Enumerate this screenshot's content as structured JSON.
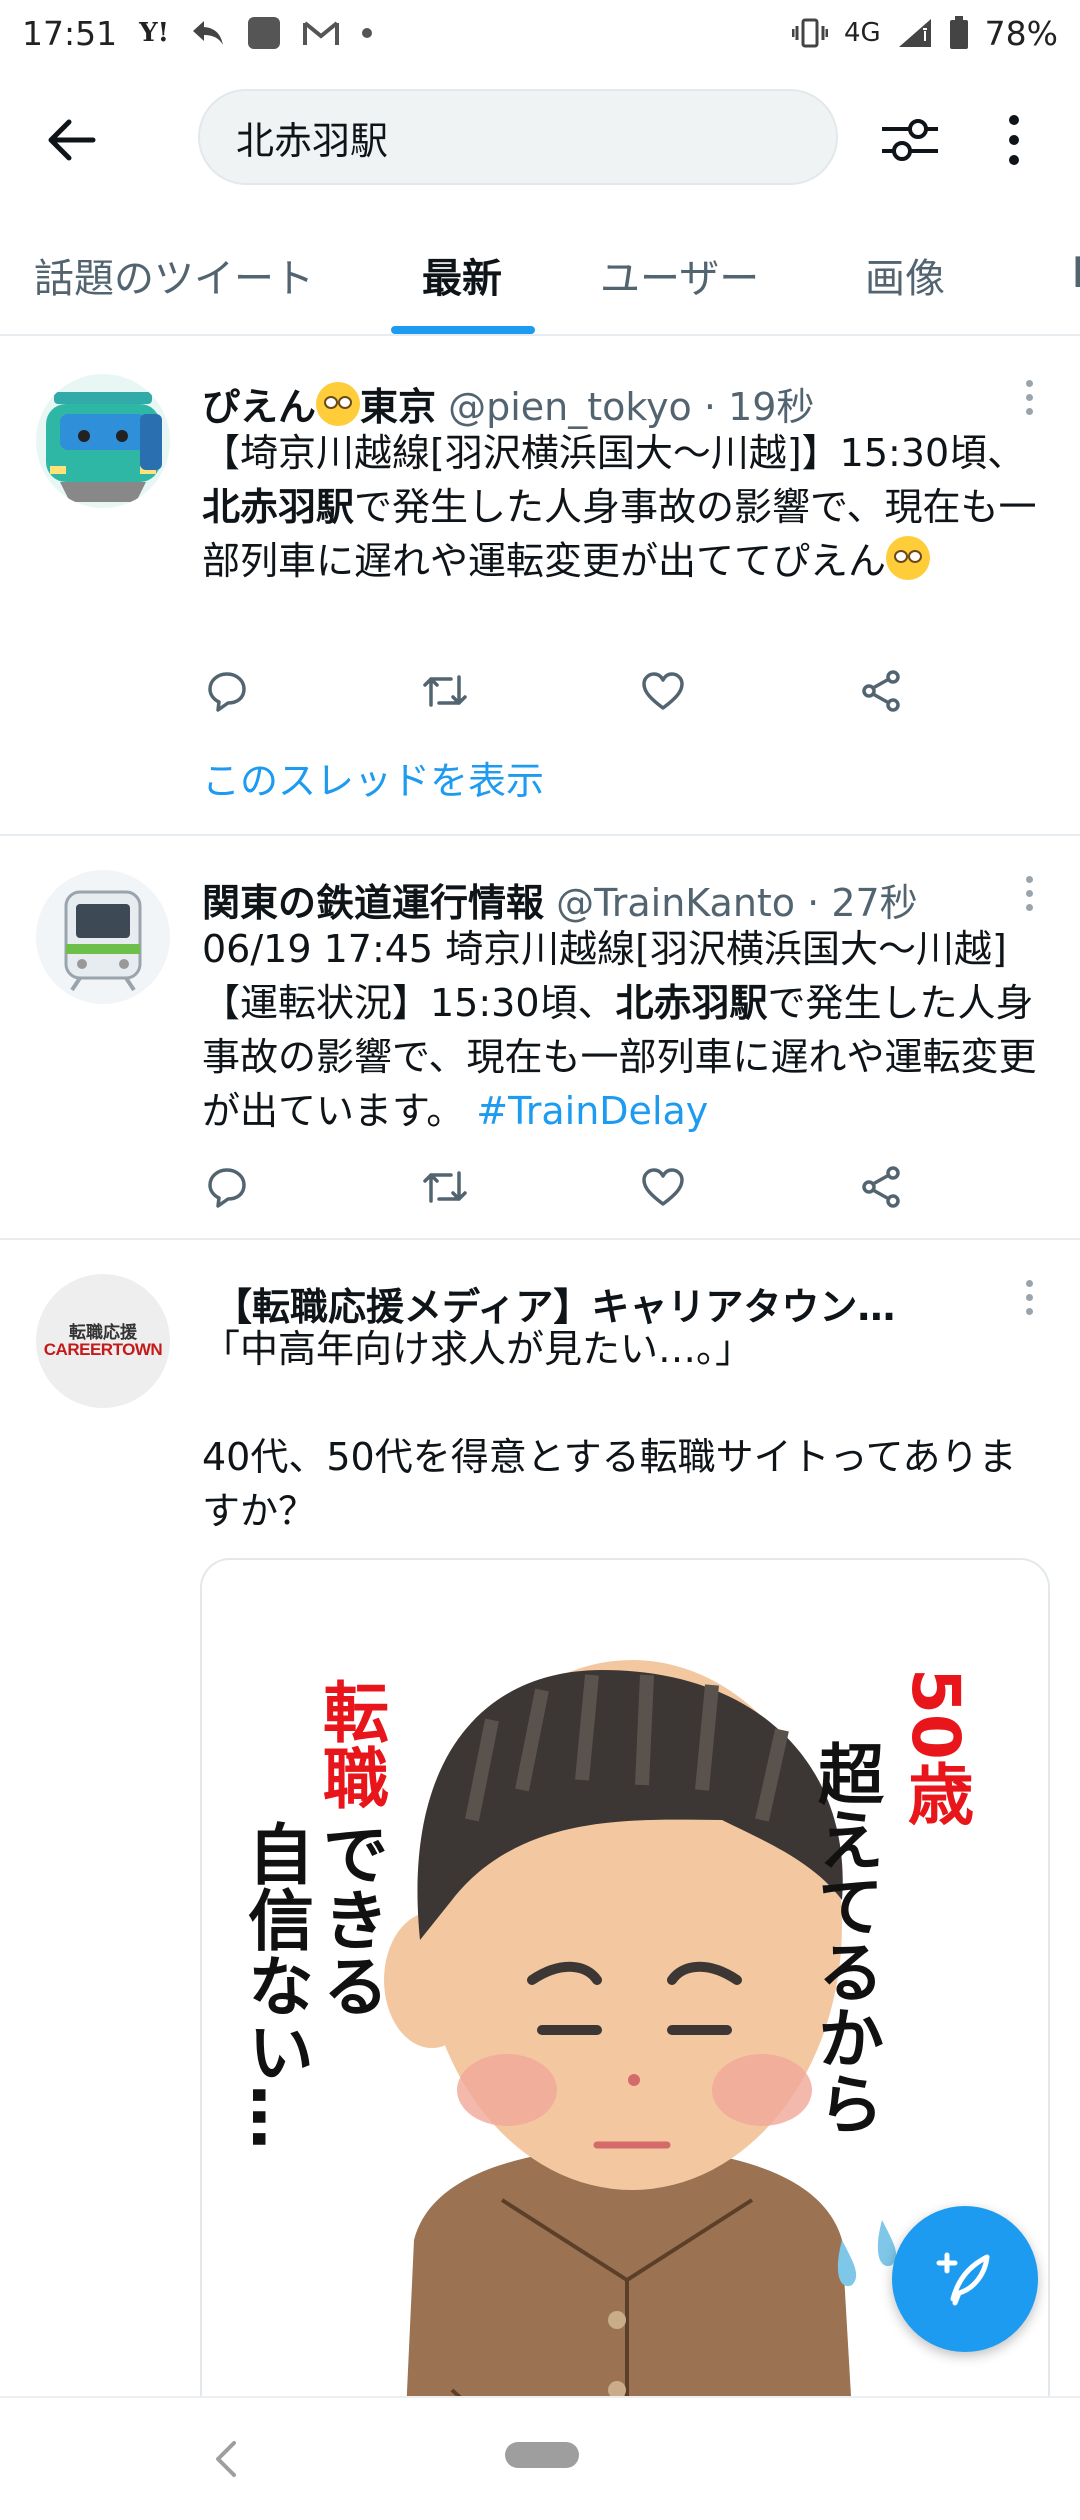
{
  "status_bar": {
    "time": "17:51",
    "network": "4G",
    "battery": "78%"
  },
  "app_bar": {
    "search_value": "北赤羽駅"
  },
  "tabs": [
    {
      "label": "話題のツイート",
      "active": false
    },
    {
      "label": "最新",
      "active": true
    },
    {
      "label": "ユーザー",
      "active": false
    },
    {
      "label": "画像",
      "active": false
    }
  ],
  "tweets": [
    {
      "name_prefix": "ぴえん",
      "name_suffix": "東京",
      "handle": "@pien_tokyo",
      "time": "19秒",
      "text_1": "【埼京川越線[羽沢横浜国大〜川越]】15:30頃、",
      "text_bold": "北赤羽駅",
      "text_2": "で発生した人身事故の影響で、現在も一部列車に遅れや運転変更が出ててぴえん",
      "thread_link": "このスレッドを表示"
    },
    {
      "name": "関東の鉄道運行情報",
      "handle": "@TrainKanto",
      "time": "27秒",
      "text_1": "06/19 17:45 埼京川越線[羽沢横浜国大〜川越]【運転状況】15:30頃、",
      "text_bold": "北赤羽駅",
      "text_2": "で発生した人身事故の影響で、現在も一部列車に遅れや運転変更が出ています。 ",
      "hashtag": "#TrainDelay"
    },
    {
      "name": "【転職応援メディア】キャリアタウン…",
      "text_1": "「中高年向け求人が見たい…。」",
      "text_2": "40代、50代を得意とする転職サイトってありますか？",
      "avatar_text_top": "転職応援",
      "avatar_text_bottom": "CAREERTOWN",
      "image_text_left_red": "転職",
      "image_text_left_1": "できる",
      "image_text_left_2": "自信ない…",
      "image_text_right_red": "50歳",
      "image_text_right": "超えてるから"
    }
  ],
  "colors": {
    "accent": "#1d9bf0",
    "text": "#0f1419",
    "muted": "#536471",
    "highlight_red": "#e8151b"
  }
}
